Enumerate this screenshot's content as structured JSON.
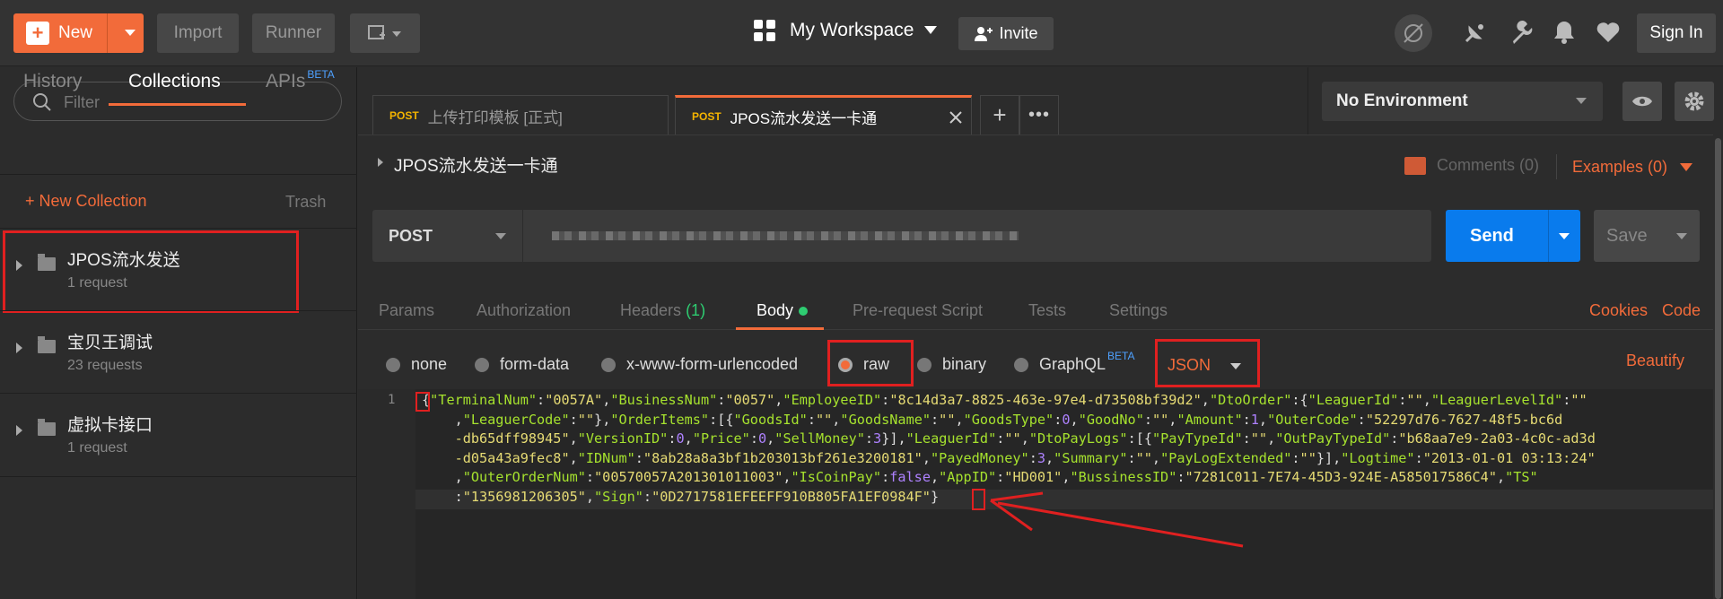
{
  "topbar": {
    "new_label": "New",
    "import_label": "Import",
    "runner_label": "Runner",
    "workspace": "My Workspace",
    "invite": "Invite",
    "signin": "Sign In"
  },
  "sidebar": {
    "filter_placeholder": "Filter",
    "tabs": {
      "history": "History",
      "collections": "Collections",
      "apis": "APIs",
      "beta": "BETA"
    },
    "new_collection": "+ New Collection",
    "trash": "Trash",
    "collections": [
      {
        "name": "JPOS流水发送",
        "count": "1 request"
      },
      {
        "name": "宝贝王调试",
        "count": "23 requests"
      },
      {
        "name": "虚拟卡接口",
        "count": "1 request"
      }
    ]
  },
  "tabs": [
    {
      "method": "POST",
      "title": "上传打印模板 [正式]"
    },
    {
      "method": "POST",
      "title": "JPOS流水发送一卡通"
    }
  ],
  "environment": "No Environment",
  "request": {
    "name": "JPOS流水发送一卡通",
    "comments": "Comments (0)",
    "examples": "Examples (0)",
    "method": "POST",
    "send": "Send",
    "save": "Save"
  },
  "req_tabs": {
    "params": "Params",
    "authorization": "Authorization",
    "headers": "Headers",
    "headers_count": "(1)",
    "body": "Body",
    "prerequest": "Pre-request Script",
    "tests": "Tests",
    "settings": "Settings",
    "cookies": "Cookies",
    "code": "Code"
  },
  "body_modes": {
    "none": "none",
    "form_data": "form-data",
    "urlencoded": "x-www-form-urlencoded",
    "raw": "raw",
    "binary": "binary",
    "graphql": "GraphQL",
    "beta": "BETA",
    "format": "JSON",
    "beautify": "Beautify"
  },
  "editor": {
    "line_number": "1"
  },
  "colors": {
    "accent": "#f26b3a",
    "send": "#097bed",
    "annotation": "#e02020"
  }
}
